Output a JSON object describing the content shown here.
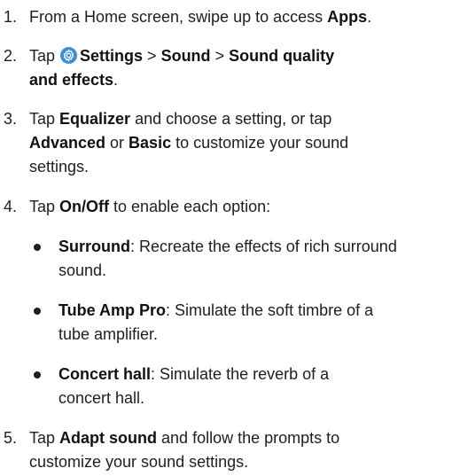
{
  "steps": [
    {
      "number": "1.",
      "parts": [
        "From a Home screen, swipe up to access ",
        "Apps",
        "."
      ]
    },
    {
      "number": "2.",
      "parts": [
        "Tap ",
        "Settings",
        " > ",
        "Sound",
        " > ",
        "Sound quality",
        "and effects",
        "."
      ],
      "icon": "settings-gear-icon"
    },
    {
      "number": "3.",
      "parts": [
        "Tap ",
        "Equalizer",
        " and choose a setting, or tap",
        "Advanced",
        " or ",
        "Basic",
        " to customize your sound",
        "settings."
      ]
    },
    {
      "number": "4.",
      "parts": [
        "Tap ",
        "On/Off",
        " to enable each option:"
      ]
    },
    {
      "number": "5.",
      "parts": [
        "Tap ",
        "Adapt sound",
        " and follow the prompts to",
        "customize your sound settings."
      ]
    }
  ],
  "options": [
    {
      "name": "Surround",
      "desc_line1": ": Recreate the effects of rich surround",
      "desc_line2": "sound."
    },
    {
      "name": "Tube Amp Pro",
      "desc_line1": ": Simulate the soft timbre of a",
      "desc_line2": "tube amplifier."
    },
    {
      "name": "Concert hall",
      "desc_line1": ": Simulate the reverb of a",
      "desc_line2": "concert hall."
    }
  ],
  "colors": {
    "text": "#1e1e1e",
    "gear_icon_bg": "#3b8edb"
  }
}
